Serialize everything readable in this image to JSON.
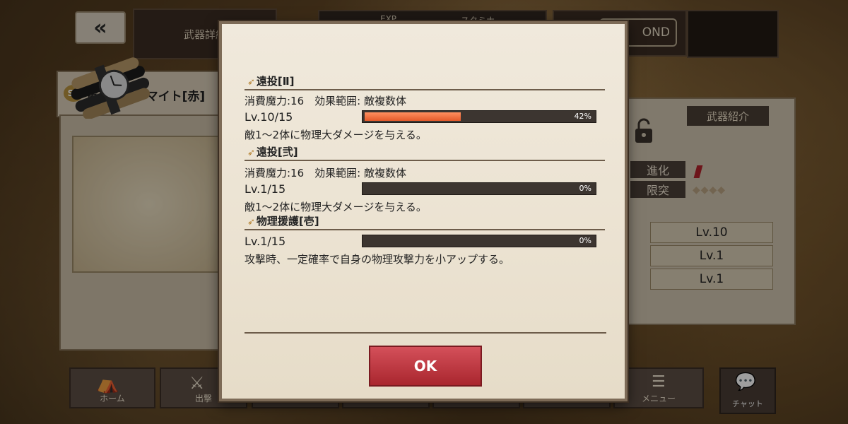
{
  "header": {
    "back_label": "«",
    "screen_title": "武器詳細",
    "exp_label": "EXP",
    "stamina_label": "スタミナ",
    "diamond_label": "OND"
  },
  "weapon": {
    "rank_badge": "SS",
    "name": "軍用ダイナマイト[赤]"
  },
  "info_panel": {
    "intro_button": "武器紹介",
    "evolution_label": "進化",
    "limit_break_label": "限突",
    "limit_break_value": "◆◆◆◆",
    "skill_levels": [
      "Lv.10",
      "Lv.1",
      "Lv.1"
    ]
  },
  "dialog": {
    "skills": [
      {
        "name": "遠投[Ⅱ]",
        "cost": "消費魔力:16　効果範囲: 敵複数体",
        "level": "Lv.10/15",
        "progress_pct": "42%",
        "progress": 0.42,
        "description": "敵1～2体に物理大ダメージを与える。"
      },
      {
        "name": "遠投[弐]",
        "cost": "消費魔力:16　効果範囲: 敵複数体",
        "level": "Lv.1/15",
        "progress_pct": "0%",
        "progress": 0,
        "description": "敵1～2体に物理大ダメージを与える。"
      },
      {
        "name": "物理援護[壱]",
        "cost": "",
        "level": "Lv.1/15",
        "progress_pct": "0%",
        "progress": 0,
        "description": "攻撃時、一定確率で自身の物理攻撃力を小アップする。"
      }
    ],
    "ok_label": "OK"
  },
  "nav": {
    "items": [
      "ホーム",
      "出撃",
      "",
      "",
      "",
      "",
      "",
      "メニュー"
    ],
    "chat_label": "チャット"
  },
  "colors": {
    "progress_fill": "#e45a2a",
    "ok_button": "#b8323a"
  }
}
